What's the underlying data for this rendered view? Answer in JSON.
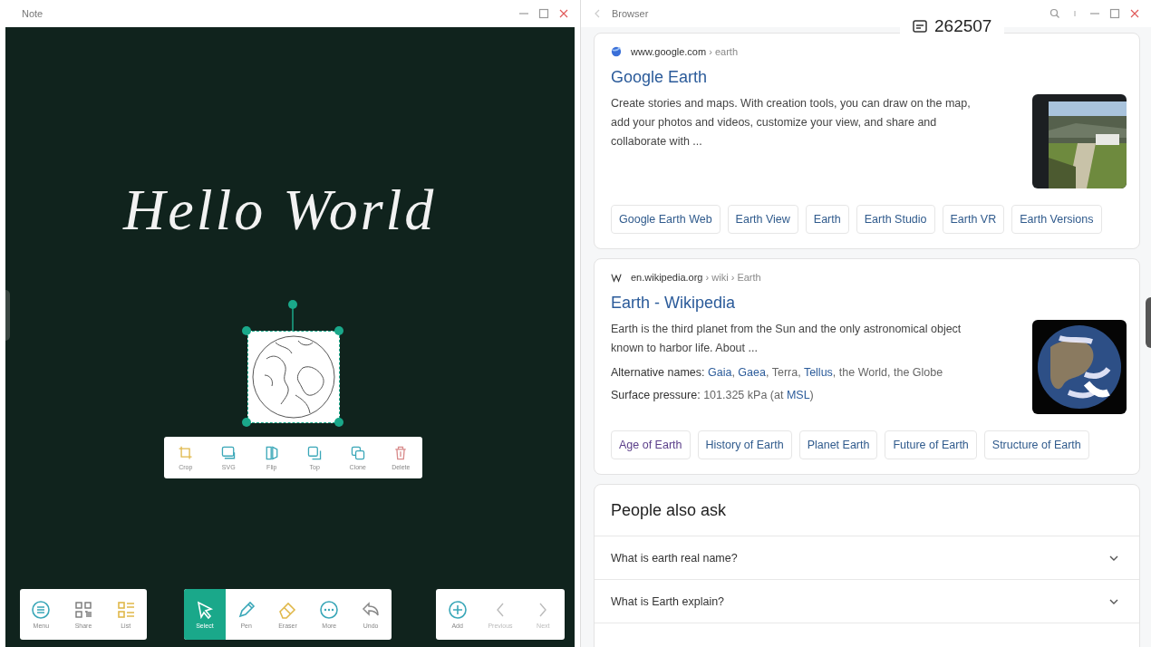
{
  "note": {
    "title": "Note",
    "handwriting": "Hello World",
    "context_tools": [
      {
        "label": "Crop"
      },
      {
        "label": "SVG"
      },
      {
        "label": "Flip"
      },
      {
        "label": "Top"
      },
      {
        "label": "Clone"
      },
      {
        "label": "Delete"
      }
    ],
    "toolbar_left": [
      {
        "label": "Menu"
      },
      {
        "label": "Share"
      },
      {
        "label": "List"
      }
    ],
    "toolbar_tools": [
      {
        "label": "Select",
        "selected": true
      },
      {
        "label": "Pen",
        "selected": false
      },
      {
        "label": "Eraser",
        "selected": false
      },
      {
        "label": "More",
        "selected": false
      },
      {
        "label": "Undo",
        "selected": false
      }
    ],
    "toolbar_pages": [
      {
        "label": "Add",
        "disabled": false
      },
      {
        "label": "Previous",
        "disabled": true
      },
      {
        "label": "Next",
        "disabled": true
      }
    ]
  },
  "browser": {
    "title": "Browser",
    "badge": "262507",
    "results": [
      {
        "kind": "google",
        "site": "www.google.com",
        "path": " › earth",
        "title": "Google Earth",
        "snippet": "Create stories and maps. With creation tools, you can draw on the map, add your photos and videos, customize your view, and share and collaborate with  ...",
        "thumbnail": {
          "kind": "picture"
        },
        "chips": [
          {
            "label": "Google Earth Web",
            "visited": false
          },
          {
            "label": "Earth View",
            "visited": false
          },
          {
            "label": "Earth",
            "visited": false
          },
          {
            "label": "Earth Studio",
            "visited": false
          },
          {
            "label": "Earth VR",
            "visited": false
          },
          {
            "label": "Earth Versions",
            "visited": false
          }
        ]
      },
      {
        "kind": "wikipedia",
        "site": "en.wikipedia.org",
        "path": " › wiki › Earth",
        "title": "Earth - Wikipedia",
        "snippet": "Earth is the third planet from the Sun and the only astronomical object known to harbor life. About ...",
        "thumbnail": {
          "kind": "picture"
        },
        "facts": [
          {
            "label": "Alternative names:",
            "parts": [
              {
                "text": "Gaia",
                "link": true
              },
              {
                "text": ", ",
                "link": false
              },
              {
                "text": "Gaea",
                "link": true
              },
              {
                "text": ", Terra, ",
                "link": false
              },
              {
                "text": "Tellus",
                "link": true
              },
              {
                "text": ", the World, the Globe",
                "link": false
              }
            ]
          },
          {
            "label": "Surface pressure:",
            "parts": [
              {
                "text": "101.325 kPa (at ",
                "link": false
              },
              {
                "text": "MSL",
                "link": true
              },
              {
                "text": ")",
                "link": false
              }
            ]
          }
        ],
        "chips": [
          {
            "label": "Age of Earth",
            "visited": true
          },
          {
            "label": "History of Earth",
            "visited": false
          },
          {
            "label": "Planet Earth",
            "visited": false
          },
          {
            "label": "Future of Earth",
            "visited": false
          },
          {
            "label": "Structure of Earth",
            "visited": false
          }
        ]
      }
    ],
    "people_also_ask": {
      "heading": "People also ask",
      "questions": [
        {
          "text": "What is earth real name?",
          "expanded": false
        },
        {
          "text": "What is Earth explain?",
          "expanded": false
        }
      ]
    }
  }
}
